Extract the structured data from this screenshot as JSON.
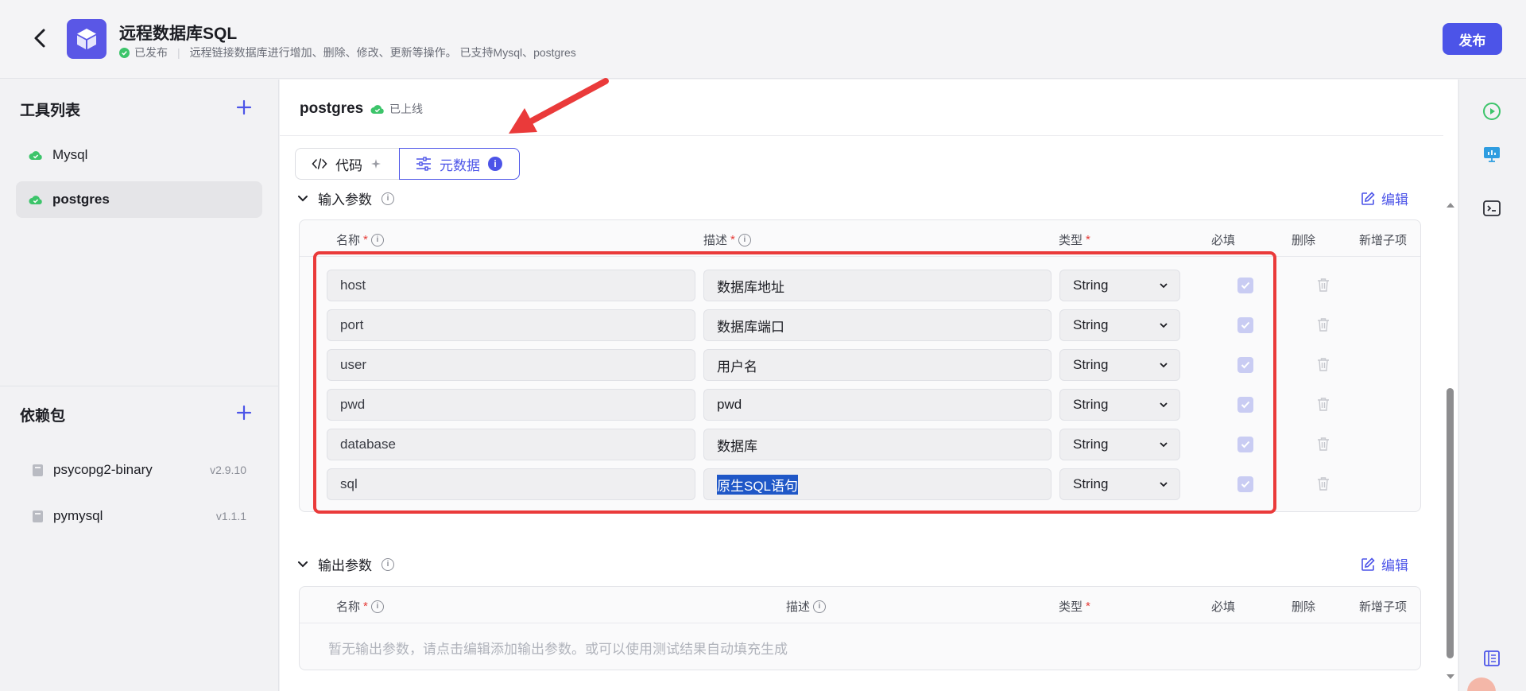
{
  "header": {
    "app_title": "远程数据库SQL",
    "status": "已发布",
    "description": "远程链接数据库进行增加、删除、修改、更新等操作。 已支持Mysql、postgres",
    "publish_label": "发布",
    "logo_color": "#5a57e6"
  },
  "sidebar": {
    "tools_title": "工具列表",
    "tools": [
      {
        "label": "Mysql",
        "active": false
      },
      {
        "label": "postgres",
        "active": true
      }
    ],
    "deps_title": "依赖包",
    "deps": [
      {
        "name": "psycopg2-binary",
        "version": "v2.9.10"
      },
      {
        "name": "pymysql",
        "version": "v1.1.1"
      }
    ]
  },
  "main": {
    "tool_name": "postgres",
    "online_label": "已上线",
    "tabs": {
      "code": "代码",
      "metadata": "元数据",
      "metadata_badge": "i"
    },
    "input_section": {
      "title": "输入参数",
      "edit_label": "编辑",
      "columns": {
        "name": "名称",
        "desc": "描述",
        "type": "类型",
        "required": "必填",
        "delete": "删除",
        "add_child": "新增子项"
      },
      "rows": [
        {
          "name": "host",
          "desc": "数据库地址",
          "type": "String",
          "required": true
        },
        {
          "name": "port",
          "desc": "数据库端口",
          "type": "String",
          "required": true
        },
        {
          "name": "user",
          "desc": "用户名",
          "type": "String",
          "required": true
        },
        {
          "name": "pwd",
          "desc": "pwd",
          "type": "String",
          "required": true
        },
        {
          "name": "database",
          "desc": "数据库",
          "type": "String",
          "required": true
        },
        {
          "name": "sql",
          "desc": "原生SQL语句",
          "type": "String",
          "required": true
        }
      ]
    },
    "output_section": {
      "title": "输出参数",
      "edit_label": "编辑",
      "columns": {
        "name": "名称",
        "desc": "描述",
        "type": "类型",
        "required": "必填",
        "delete": "删除",
        "add_child": "新增子项"
      },
      "empty_message": "暂无输出参数，请点击编辑添加输出参数。或可以使用测试结果自动填充生成"
    }
  },
  "colors": {
    "accent": "#4c54e8",
    "success": "#3cc46a",
    "highlight": "#ea3a3a"
  }
}
